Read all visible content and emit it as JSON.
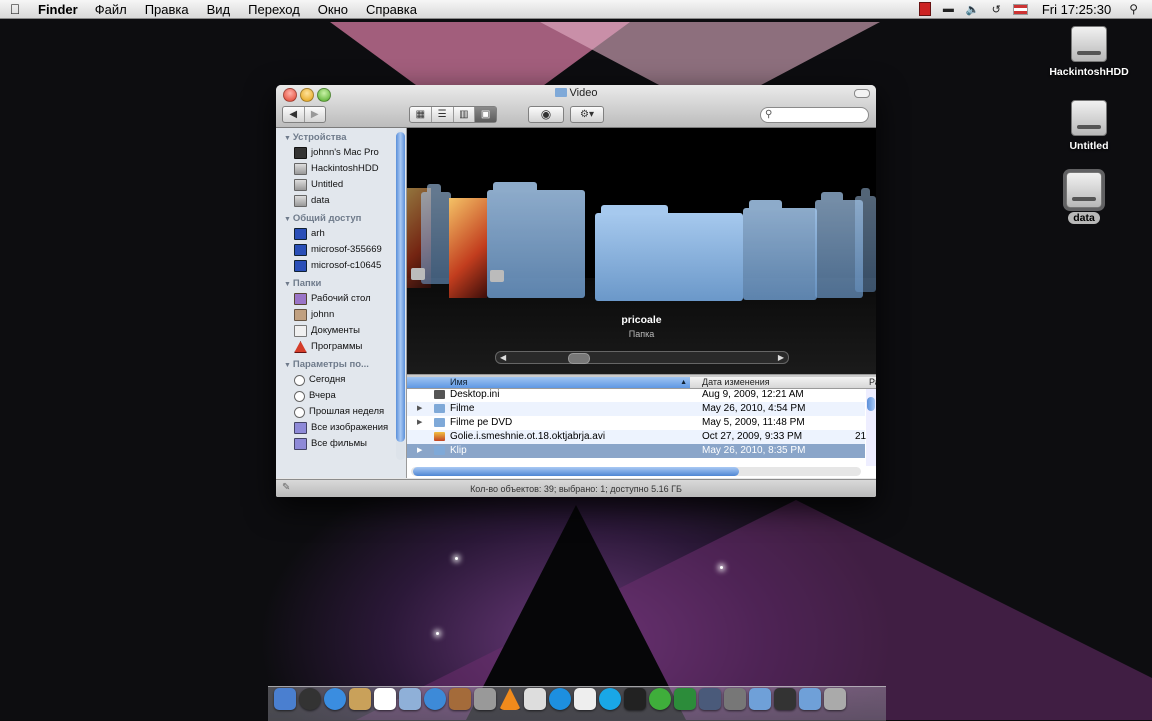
{
  "menubar": {
    "apple": "",
    "app": "Finder",
    "items": [
      "Файл",
      "Правка",
      "Вид",
      "Переход",
      "Окно",
      "Справка"
    ],
    "clock": "Fri 17:25:30"
  },
  "desktop": {
    "icons": [
      "HackintoshHDD",
      "Untitled",
      "data"
    ]
  },
  "window": {
    "title": "Video",
    "search": {
      "value": "",
      "placeholder": ""
    },
    "sidebar": {
      "devices_header": "Устройства",
      "devices": [
        "johnn's Mac Pro",
        "HackintoshHDD",
        "Untitled",
        "data"
      ],
      "shared_header": "Общий доступ",
      "shared": [
        "arh",
        "microsof-355669",
        "microsof-c10645"
      ],
      "places_header": "Папки",
      "places": [
        "Рабочий стол",
        "johnn",
        "Документы",
        "Программы"
      ],
      "search_header": "Параметры по...",
      "search_for": [
        "Сегодня",
        "Вчера",
        "Прошлая неделя",
        "Все изображения",
        "Все фильмы"
      ]
    },
    "coverflow": {
      "name": "pricoale",
      "kind": "Папка"
    },
    "list": {
      "col_name": "Имя",
      "col_date": "Дата изменения",
      "col_size": "Ра",
      "rows": [
        {
          "name": "Desktop.ini",
          "date": "Aug 9, 2009, 12:21 AM",
          "size": ""
        },
        {
          "name": "Filme",
          "date": "May 26, 2010, 4:54 PM",
          "size": ""
        },
        {
          "name": "Filme pe DVD",
          "date": "May 5, 2009, 11:48 PM",
          "size": ""
        },
        {
          "name": "Golie.i.smeshnie.ot.18.oktjabrja.avi",
          "date": "Oct 27, 2009, 9:33 PM",
          "size": "21"
        },
        {
          "name": "Klip",
          "date": "May 26, 2010, 8:35 PM",
          "size": ""
        }
      ]
    },
    "status": "Кол-во объектов: 39; выбрано: 1; доступно 5.16 ГБ"
  },
  "colors": {
    "selection": "#8aa5c9",
    "sidebar_bg": "#e2e7ed",
    "folder": "#7fa9d8"
  }
}
